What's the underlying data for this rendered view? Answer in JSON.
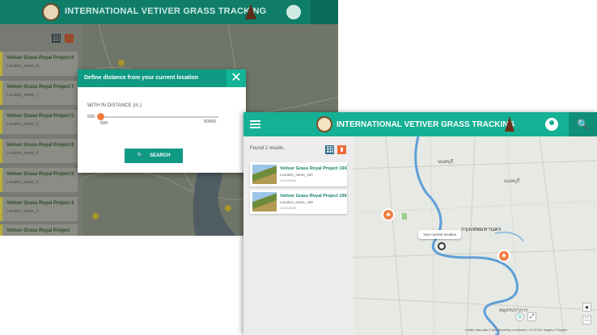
{
  "app": {
    "title": "INTERNATIONAL VETIVER GRASS TRACKING"
  },
  "back_window": {
    "sidebar_items": [
      {
        "title": "Vetiver Grass Royal Project 8",
        "subtitle": "Location_name_8"
      },
      {
        "title": "Vetiver Grass Royal Project 7",
        "subtitle": "Location_name_7"
      },
      {
        "title": "Vetiver Grass Royal Project 5",
        "subtitle": "Location_name_5"
      },
      {
        "title": "Vetiver Grass Royal Project 6",
        "subtitle": "Location_name_6"
      },
      {
        "title": "Vetiver Grass Royal Project 9",
        "subtitle": "Location_name_9"
      },
      {
        "title": "Vetiver Grass Royal Project 3",
        "subtitle": "Location_name_3"
      },
      {
        "title": "Vetiver Grass Royal Project",
        "subtitle": ""
      }
    ],
    "modal": {
      "title": "Define distance from your current location",
      "close": "✕",
      "label": "WITH IN DISTANCE (m.)",
      "slider_min": "500",
      "slider_max": "50000",
      "slider_value": "500",
      "slider_level": 0,
      "search_label": "SEARCH",
      "search_icon": "🔍"
    }
  },
  "front_window": {
    "found_text": "Found 2 results",
    "results": [
      {
        "title": "Vetiver Grass Royal Project 194",
        "subtitle": "Location_name_194",
        "meta": "19/04/2560"
      },
      {
        "title": "Vetiver Grass Royal Project 199",
        "subtitle": "Location_name_199",
        "meta": "19/04/2560"
      }
    ],
    "map": {
      "current_location_label": "Your current location",
      "city_label": "กรุงเทพมหานคร",
      "place_labels": [
        "นนทบุรี",
        "สมุทรปราการ"
      ],
      "attribution": "Leaflet | Map data © OpenStreetMap contributors, CC-BY-SA, Imagery © Mapbox"
    }
  },
  "colors": {
    "teal": "#16b095",
    "teal_dark": "#0f8f78",
    "orange": "#f07d40"
  }
}
